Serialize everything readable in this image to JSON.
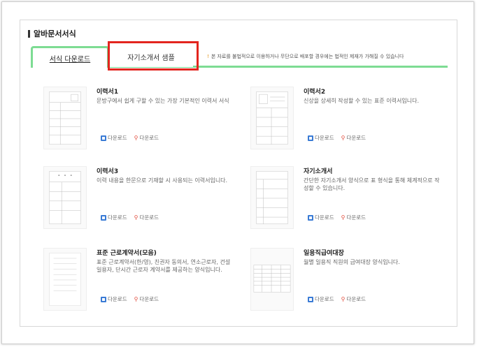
{
  "section": {
    "title": "알바문서서식"
  },
  "tabs": [
    {
      "label": "서식 다운로드",
      "active": true
    },
    {
      "label": "자기소개서 샘플",
      "active": false
    }
  ],
  "notice": "본 자료를 불법적으로 이용하거나 무단으로 배포할 경우에는 법적인 제재가 가해질 수 있습니다",
  "download_label": "다운로드",
  "documents": [
    {
      "title": "이력서1",
      "desc": "문방구에서 쉽게 구할 수 있는 가장 기본적인 이력서 서식"
    },
    {
      "title": "이력서2",
      "desc": "신상을 상세히 작성할 수 있는 표준 이력서입니다."
    },
    {
      "title": "이력서3",
      "desc": "이력 내용을 한문으로 기재할 시 사용되는 이력서입니다."
    },
    {
      "title": "자기소개서",
      "desc": "간단한 자기소개서 양식으로 표 형식을 통해 체계적으로 작성할 수 있습니다."
    },
    {
      "title": "표준 근로계약서(모음)",
      "desc": "표준 근로계약서(한/영), 친권자 동의서, 연소근로자, 건설 일용자, 단시간 근로자 계약서를 제공하는 양식입니다."
    },
    {
      "title": "일용직급여대장",
      "desc": "월별 일용직 직원의 급여대장 양식입니다."
    }
  ],
  "colors": {
    "tab_green": "#7ddc93",
    "highlight_red": "#e3251e",
    "icon_blue": "#3a7bd5",
    "icon_red": "#e14b3b"
  }
}
